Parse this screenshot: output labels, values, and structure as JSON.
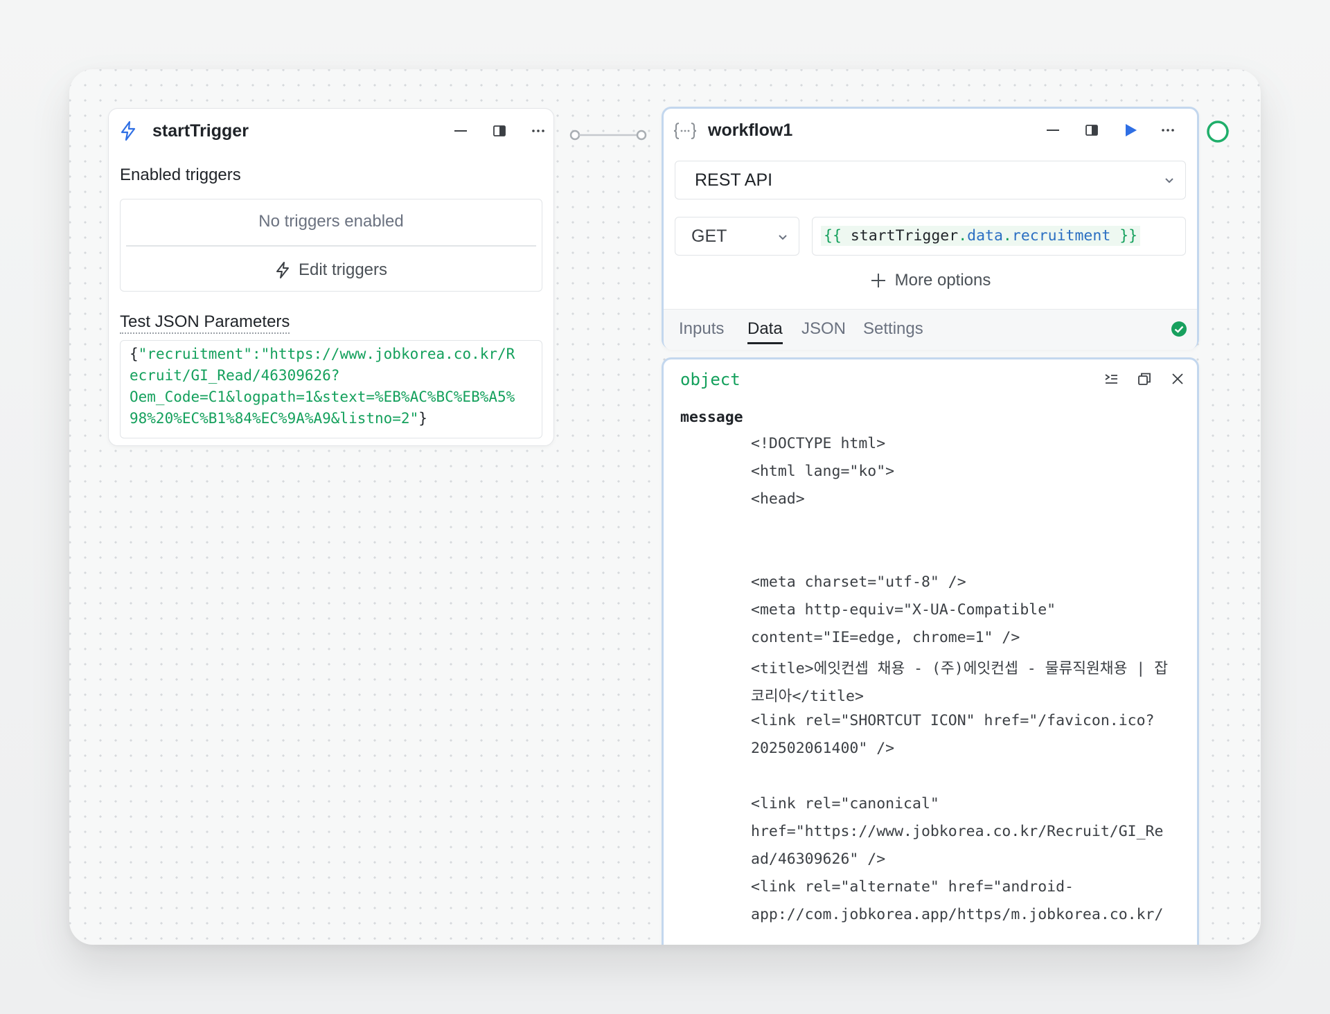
{
  "trigger_card": {
    "title": "startTrigger",
    "enabled_triggers_label": "Enabled triggers",
    "no_triggers_text": "No triggers enabled",
    "edit_triggers_label": "Edit triggers",
    "test_json_label": "Test JSON Parameters",
    "json_lines": [
      "{\"recruitment\":\"https://www.jobkorea.co.kr/R",
      "ecruit/GI_Read/46309626?",
      "Oem_Code=C1&logpath=1&stext=%EB%AC%BC%EB%A5%",
      "98%20%EC%B1%84%EC%9A%A9&listno=2\"}"
    ]
  },
  "workflow_card": {
    "title": "workflow1",
    "resource_type": "REST API",
    "method": "GET",
    "url_expression": {
      "open": "{{",
      "ref": "startTrigger",
      "dot1": ".",
      "prop1": "data",
      "dot2": ".",
      "prop2": "recruitment",
      "close": "}}"
    },
    "more_options_label": "More options",
    "tabs": [
      {
        "label": "Inputs",
        "active": false
      },
      {
        "label": "Data",
        "active": true
      },
      {
        "label": "JSON",
        "active": false
      },
      {
        "label": "Settings",
        "active": false
      }
    ],
    "status": "success"
  },
  "result_panel": {
    "type_label": "object",
    "key_label": "message",
    "lines": [
      "<!DOCTYPE html>",
      "<html lang=\"ko\">",
      "<head>",
      "",
      "",
      "<meta charset=\"utf-8\" />",
      "<meta http-equiv=\"X-UA-Compatible\"",
      "content=\"IE=edge, chrome=1\" />",
      "<title>에잇컨셉 채용 - (주)에잇컨셉 - 물류직원채용 | 잡",
      "코리아</title>",
      "<link rel=\"SHORTCUT ICON\" href=\"/favicon.ico?",
      "202502061400\" />",
      "",
      "<link rel=\"canonical\"",
      "href=\"https://www.jobkorea.co.kr/Recruit/GI_Re",
      "ad/46309626\" />",
      "<link rel=\"alternate\" href=\"android-",
      "app://com.jobkorea.app/https/m.jobkorea.co.kr/"
    ]
  },
  "colors": {
    "accent_blue": "#2f6fe4",
    "success_green": "#18a05e",
    "code_green": "#14a05c",
    "selected_border": "#c3d7ee"
  }
}
